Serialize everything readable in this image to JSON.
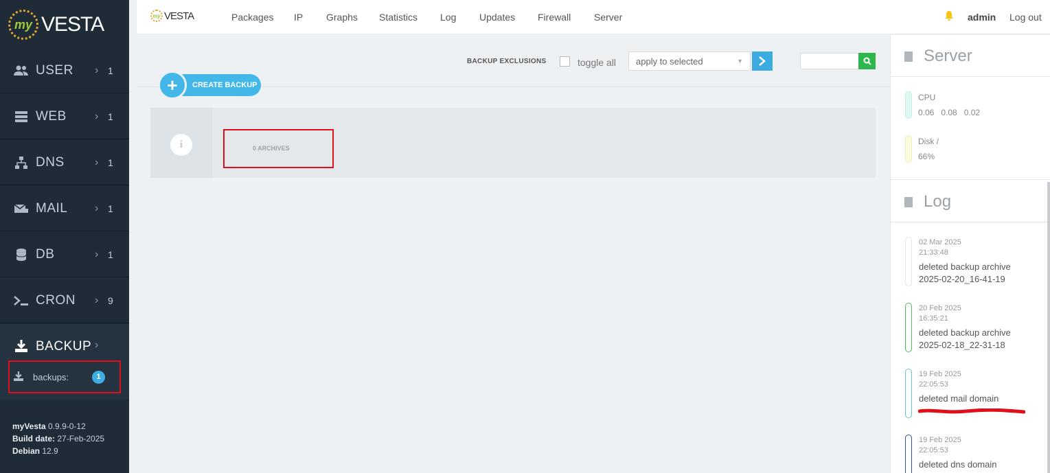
{
  "brand": {
    "logo_text": "VESTA",
    "logo_prefix": "my",
    "small_logo_text": "VESTA"
  },
  "topnav": {
    "links": [
      "Packages",
      "IP",
      "Graphs",
      "Statistics",
      "Log",
      "Updates",
      "Firewall",
      "Server"
    ],
    "user": "admin",
    "logout": "Log out"
  },
  "sidebar": {
    "items": [
      {
        "label": "USER",
        "count": "1",
        "icon": "user-icon"
      },
      {
        "label": "WEB",
        "count": "1",
        "icon": "server-icon"
      },
      {
        "label": "DNS",
        "count": "1",
        "icon": "network-icon"
      },
      {
        "label": "MAIL",
        "count": "1",
        "icon": "mail-icon"
      },
      {
        "label": "DB",
        "count": "1",
        "icon": "database-icon"
      },
      {
        "label": "CRON",
        "count": "9",
        "icon": "terminal-icon"
      },
      {
        "label": "BACKUP",
        "count": "",
        "icon": "download-icon"
      }
    ],
    "sub_item": {
      "label": "backups:",
      "badge": "1"
    },
    "version": {
      "name": "myVesta",
      "version": "0.9.9-0-12",
      "build_label": "Build date:",
      "build_date": "27-Feb-2025",
      "os_label": "Debian",
      "os_version": "12.9"
    }
  },
  "toolbar": {
    "create_label": "CREATE BACKUP",
    "exclusions": "BACKUP EXCLUSIONS",
    "toggle_all": "toggle all",
    "select_value": "apply to selected",
    "search_value": ""
  },
  "main": {
    "archives_label": "0 ARCHIVES"
  },
  "server_panel": {
    "title": "Server",
    "cpu_label": "CPU",
    "cpu_values": "0.06   0.08   0.02",
    "disk_label": "Disk /",
    "disk_value": "66%"
  },
  "log_panel": {
    "title": "Log",
    "entries": [
      {
        "date": "02  Mar  2025",
        "time": "21:33:48",
        "msg1": "deleted backup archive",
        "msg2": "2025-02-20_16-41-19",
        "color": "#e2e5e8"
      },
      {
        "date": "20  Feb  2025",
        "time": "16:35:21",
        "msg1": "deleted backup archive",
        "msg2": "2025-02-18_22-31-18",
        "color": "#4cbf5b"
      },
      {
        "date": "19  Feb  2025",
        "time": "22:05:53",
        "msg1": "deleted mail domain",
        "msg2": "",
        "color": "#5fc8c8"
      },
      {
        "date": "19  Feb  2025",
        "time": "22:05:53",
        "msg1": "deleted dns domain",
        "msg2": "",
        "color": "#2f4fa8"
      }
    ]
  },
  "colors": {
    "sidebar_bg": "#1f2b37",
    "accent": "#43b7e8",
    "highlight": "#e0101a",
    "search_btn": "#2fb64d"
  }
}
